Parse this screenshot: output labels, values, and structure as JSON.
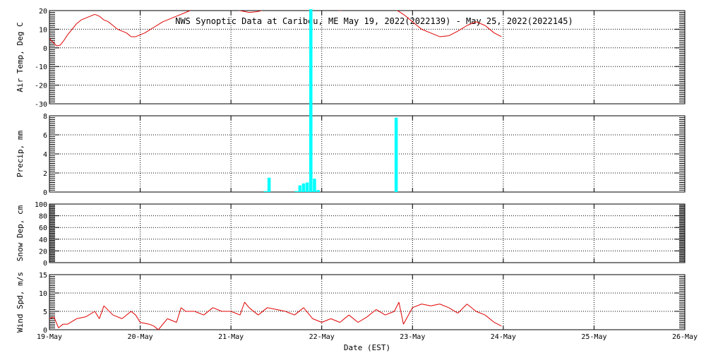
{
  "title": "NWS Synoptic Data at Caribou, ME   May 19, 2022(2022139) - May 25, 2022(2022145)",
  "xlabel": "Date (EST)",
  "colors": {
    "temp_line": "#e00000",
    "precip_bar": "#00ffff",
    "wind_line": "#e00000",
    "axis": "#000000"
  },
  "chart_data": [
    {
      "type": "line",
      "panel": "air_temp",
      "ylabel": "Air Temp, Deg C",
      "xlim": [
        0,
        7
      ],
      "ylim": [
        -30,
        20
      ],
      "yticks": [
        -30,
        -20,
        -10,
        0,
        10,
        20
      ],
      "xticks": [
        0,
        1,
        2,
        3,
        4,
        5,
        6,
        7
      ],
      "xticklabels": [
        "19-May",
        "20-May",
        "21-May",
        "22-May",
        "23-May",
        "24-May",
        "25-May",
        "26-May"
      ],
      "grid": true,
      "x": [
        0,
        0.04,
        0.08,
        0.12,
        0.16,
        0.2,
        0.25,
        0.3,
        0.35,
        0.4,
        0.45,
        0.5,
        0.55,
        0.6,
        0.65,
        0.7,
        0.75,
        0.8,
        0.85,
        0.9,
        0.95,
        1.0,
        1.05,
        1.1,
        1.15,
        1.2,
        1.25,
        1.3,
        1.35,
        1.4,
        1.45,
        1.5,
        1.6,
        1.7,
        1.8,
        1.9,
        2.0,
        2.1,
        2.2,
        2.3,
        2.4,
        2.5,
        2.6,
        2.7,
        2.8,
        2.9,
        3.0,
        3.1,
        3.2,
        3.3,
        3.4,
        3.5,
        3.6,
        3.7,
        3.8,
        3.9,
        4.0,
        4.1,
        4.2,
        4.3,
        4.4,
        4.5,
        4.6,
        4.7,
        4.8,
        4.9,
        4.98
      ],
      "y": [
        5,
        3,
        1,
        1.5,
        4,
        7,
        10,
        13,
        15,
        16,
        17,
        18,
        17,
        15,
        14,
        12,
        10,
        9,
        8,
        6,
        6,
        7,
        8,
        9.5,
        11,
        12.5,
        14,
        15,
        16,
        17,
        18,
        19,
        21,
        22,
        22,
        22,
        21,
        20,
        19,
        19.5,
        21,
        22,
        23,
        24,
        24,
        23,
        22,
        21,
        20,
        21,
        22,
        23,
        24,
        23,
        21,
        18,
        14,
        10,
        8,
        6,
        6.5,
        9,
        12,
        14,
        12,
        8,
        6
      ]
    },
    {
      "type": "bar",
      "panel": "precip",
      "ylabel": "Precip, mm",
      "xlim": [
        0,
        7
      ],
      "ylim": [
        0,
        8
      ],
      "yticks": [
        0,
        2,
        4,
        6,
        8
      ],
      "xticks": [
        0,
        1,
        2,
        3,
        4,
        5,
        6,
        7
      ],
      "grid": true,
      "x": [
        2.38,
        2.42,
        2.72,
        2.76,
        2.8,
        2.84,
        2.88,
        2.92,
        2.96,
        3.82
      ],
      "y": [
        0.1,
        1.5,
        0.1,
        0.7,
        0.9,
        1.0,
        21.5,
        1.4,
        0.2,
        7.8
      ]
    },
    {
      "type": "line",
      "panel": "snow_depth",
      "ylabel": "Snow Dep, cm",
      "xlim": [
        0,
        7
      ],
      "ylim": [
        0,
        100
      ],
      "yticks": [
        0,
        20,
        40,
        60,
        80,
        100
      ],
      "xticks": [
        0,
        1,
        2,
        3,
        4,
        5,
        6,
        7
      ],
      "grid": true,
      "x": [],
      "y": []
    },
    {
      "type": "line",
      "panel": "wind_speed",
      "ylabel": "Wind Spd, m/s",
      "xlim": [
        0,
        7
      ],
      "ylim": [
        0,
        15
      ],
      "yticks": [
        0,
        5,
        10,
        15
      ],
      "xticks": [
        0,
        1,
        2,
        3,
        4,
        5,
        6,
        7
      ],
      "grid": true,
      "x": [
        0,
        0.05,
        0.1,
        0.15,
        0.2,
        0.3,
        0.4,
        0.5,
        0.55,
        0.6,
        0.7,
        0.8,
        0.9,
        0.95,
        1.0,
        1.1,
        1.15,
        1.2,
        1.3,
        1.4,
        1.45,
        1.5,
        1.6,
        1.7,
        1.8,
        1.9,
        2.0,
        2.1,
        2.15,
        2.2,
        2.3,
        2.4,
        2.5,
        2.6,
        2.7,
        2.8,
        2.9,
        3.0,
        3.1,
        3.2,
        3.3,
        3.4,
        3.5,
        3.6,
        3.7,
        3.8,
        3.85,
        3.9,
        4.0,
        4.1,
        4.2,
        4.3,
        4.4,
        4.5,
        4.6,
        4.7,
        4.8,
        4.9,
        4.98
      ],
      "y": [
        3,
        3.5,
        0.5,
        1.5,
        1.5,
        3,
        3.5,
        5,
        3,
        6.5,
        4,
        3,
        5,
        4,
        2,
        1.5,
        1,
        0,
        3,
        2,
        6,
        5,
        5,
        4,
        6,
        5,
        5,
        4,
        7.5,
        6,
        4,
        6,
        5.5,
        5,
        4,
        6,
        3,
        2,
        3,
        2,
        4,
        2,
        3.5,
        5.5,
        4,
        5,
        7.5,
        1.5,
        6,
        7,
        6.5,
        7,
        6,
        4.5,
        7,
        5,
        4,
        2,
        1
      ]
    }
  ]
}
